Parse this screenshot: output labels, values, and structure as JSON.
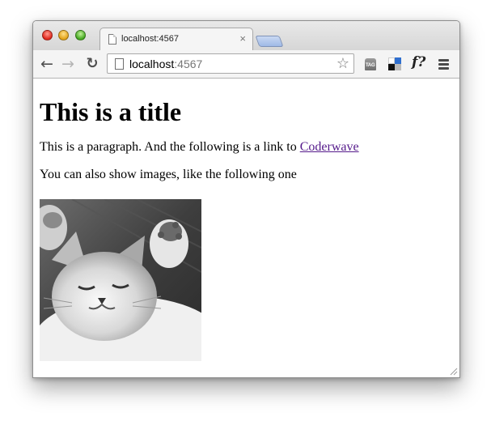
{
  "browser": {
    "tab": {
      "title": "localhost:4567",
      "close_glyph": "×"
    },
    "toolbar": {
      "back_glyph": "←",
      "forward_glyph": "→",
      "reload_glyph": "↻",
      "url_host": "localhost",
      "url_port": ":4567",
      "bookmark_glyph": "☆",
      "tag_extension_label": "TAG",
      "font_extension_label": "f?"
    }
  },
  "page": {
    "heading": "This is a title",
    "paragraph1_text": "This is a paragraph. And the following is a link to ",
    "paragraph1_link": "Coderwave",
    "paragraph2_text": "You can also show images, like the following one",
    "image": {
      "subject": "grayscale photo of a sleeping kitten lying on its back with paws raised"
    }
  },
  "colors": {
    "link": "#551a8b",
    "newtab_blue": "#9fb9e6"
  },
  "icons": [
    "close-icon",
    "back-arrow-icon",
    "forward-arrow-icon",
    "reload-icon",
    "page-icon",
    "star-icon",
    "tag-icon",
    "delicious-icon",
    "font-identifier-icon",
    "menu-icon"
  ]
}
